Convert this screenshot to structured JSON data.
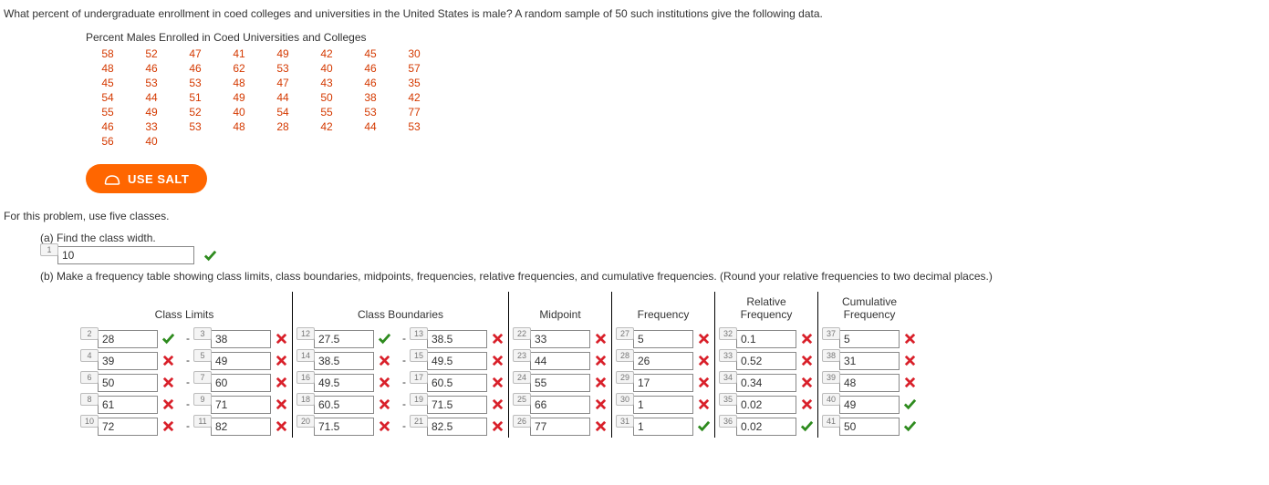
{
  "question": "What percent of undergraduate enrollment in coed colleges and universities in the United States is male? A random sample of 50 such institutions give the following data.",
  "data_title": "Percent Males Enrolled in Coed Universities and Colleges",
  "data_rows": [
    [
      "58",
      "52",
      "47",
      "41",
      "49",
      "42",
      "45",
      "30"
    ],
    [
      "48",
      "46",
      "46",
      "62",
      "53",
      "40",
      "46",
      "57"
    ],
    [
      "45",
      "53",
      "53",
      "48",
      "47",
      "43",
      "46",
      "35"
    ],
    [
      "54",
      "44",
      "51",
      "49",
      "44",
      "50",
      "38",
      "42"
    ],
    [
      "55",
      "49",
      "52",
      "40",
      "54",
      "55",
      "53",
      "77"
    ],
    [
      "46",
      "33",
      "53",
      "48",
      "28",
      "42",
      "44",
      "53"
    ],
    [
      "56",
      "40",
      "",
      "",
      "",
      "",
      "",
      ""
    ]
  ],
  "salt_label": "USE SALT",
  "instruction": "For this problem, use five classes.",
  "part_a_label": "(a) Find the class width.",
  "part_a": {
    "badge": "1",
    "value": "10",
    "correct": true
  },
  "part_b_label": "(b) Make a frequency table showing class limits, class boundaries, midpoints, frequencies, relative frequencies, and cumulative frequencies. (Round your relative frequencies to two decimal places.)",
  "headers": {
    "limits": "Class Limits",
    "boundaries": "Class Boundaries",
    "midpoint": "Midpoint",
    "frequency": "Frequency",
    "relfreq_l1": "Relative",
    "relfreq_l2": "Frequency",
    "cumfreq_l1": "Cumulative",
    "cumfreq_l2": "Frequency"
  },
  "rows": [
    {
      "ll": {
        "b": "2",
        "v": "28",
        "ok": true
      },
      "ul": {
        "b": "3",
        "v": "38",
        "ok": false
      },
      "lb": {
        "b": "12",
        "v": "27.5",
        "ok": true
      },
      "ub": {
        "b": "13",
        "v": "38.5",
        "ok": false
      },
      "mp": {
        "b": "22",
        "v": "33",
        "ok": false
      },
      "fr": {
        "b": "27",
        "v": "5",
        "ok": false
      },
      "rf": {
        "b": "32",
        "v": "0.1",
        "ok": false
      },
      "cf": {
        "b": "37",
        "v": "5",
        "ok": false
      }
    },
    {
      "ll": {
        "b": "4",
        "v": "39",
        "ok": false
      },
      "ul": {
        "b": "5",
        "v": "49",
        "ok": false
      },
      "lb": {
        "b": "14",
        "v": "38.5",
        "ok": false
      },
      "ub": {
        "b": "15",
        "v": "49.5",
        "ok": false
      },
      "mp": {
        "b": "23",
        "v": "44",
        "ok": false
      },
      "fr": {
        "b": "28",
        "v": "26",
        "ok": false
      },
      "rf": {
        "b": "33",
        "v": "0.52",
        "ok": false
      },
      "cf": {
        "b": "38",
        "v": "31",
        "ok": false
      }
    },
    {
      "ll": {
        "b": "6",
        "v": "50",
        "ok": false
      },
      "ul": {
        "b": "7",
        "v": "60",
        "ok": false
      },
      "lb": {
        "b": "16",
        "v": "49.5",
        "ok": false
      },
      "ub": {
        "b": "17",
        "v": "60.5",
        "ok": false
      },
      "mp": {
        "b": "24",
        "v": "55",
        "ok": false
      },
      "fr": {
        "b": "29",
        "v": "17",
        "ok": false
      },
      "rf": {
        "b": "34",
        "v": "0.34",
        "ok": false
      },
      "cf": {
        "b": "39",
        "v": "48",
        "ok": false
      }
    },
    {
      "ll": {
        "b": "8",
        "v": "61",
        "ok": false
      },
      "ul": {
        "b": "9",
        "v": "71",
        "ok": false
      },
      "lb": {
        "b": "18",
        "v": "60.5",
        "ok": false
      },
      "ub": {
        "b": "19",
        "v": "71.5",
        "ok": false
      },
      "mp": {
        "b": "25",
        "v": "66",
        "ok": false
      },
      "fr": {
        "b": "30",
        "v": "1",
        "ok": false
      },
      "rf": {
        "b": "35",
        "v": "0.02",
        "ok": false
      },
      "cf": {
        "b": "40",
        "v": "49",
        "ok": true
      }
    },
    {
      "ll": {
        "b": "10",
        "v": "72",
        "ok": false
      },
      "ul": {
        "b": "11",
        "v": "82",
        "ok": false
      },
      "lb": {
        "b": "20",
        "v": "71.5",
        "ok": false
      },
      "ub": {
        "b": "21",
        "v": "82.5",
        "ok": false
      },
      "mp": {
        "b": "26",
        "v": "77",
        "ok": false
      },
      "fr": {
        "b": "31",
        "v": "1",
        "ok": true
      },
      "rf": {
        "b": "36",
        "v": "0.02",
        "ok": true
      },
      "cf": {
        "b": "41",
        "v": "50",
        "ok": true
      }
    }
  ]
}
